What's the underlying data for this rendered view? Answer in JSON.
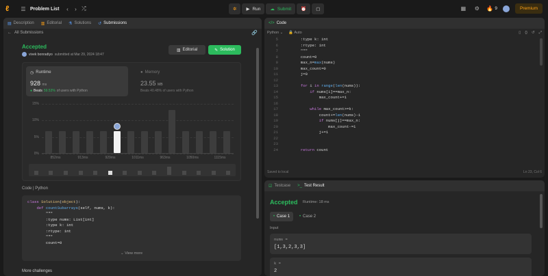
{
  "topbar": {
    "problem_list": "Problem List",
    "run": "Run",
    "submit": "Submit",
    "streak": "9",
    "premium": "Premium"
  },
  "left": {
    "tabs": [
      "Description",
      "Editorial",
      "Solutions",
      "Submissions"
    ],
    "back": "All Submissions",
    "status": "Accepted",
    "user": "vivek bonradiyo",
    "submitted": "submitted at Mar 29, 2024 18:47",
    "editorial_btn": "Editorial",
    "solution_btn": "Solution",
    "runtime_label": "Runtime",
    "runtime_value": "928",
    "runtime_unit": "ms",
    "runtime_beats_prefix": "Beats",
    "runtime_beats_pct": "59.53%",
    "runtime_beats_suffix": "of users with Python",
    "memory_label": "Memory",
    "memory_value": "23.55",
    "memory_unit": "MB",
    "memory_beats": "Beats 40.48% of users with Python",
    "code_label": "Code",
    "code_lang": "Python",
    "view_more": "View more",
    "more_challenges": "More challenges"
  },
  "chart_data": {
    "type": "bar",
    "ylim": [
      0,
      15
    ],
    "y_ticks": [
      "15%",
      "10%",
      "5%",
      "0%"
    ],
    "x_ticks": [
      "852ms",
      "913ms",
      "929ms",
      "1011ms",
      "963ms",
      "1050ms",
      "1115ms"
    ],
    "values": [
      6.5,
      6.5,
      6.5,
      6.5,
      6.5,
      6.5,
      6.5,
      6.5,
      6.5,
      13,
      6.5,
      6.5,
      6.5,
      6.5
    ],
    "highlight_index": 5
  },
  "left_code": [
    {
      "t": "class Solution(object):"
    },
    {
      "t": "    def countSubarrays(self, nums, k):"
    },
    {
      "t": "        \"\"\""
    },
    {
      "t": "        :type nums: List[int]"
    },
    {
      "t": "        :type k: int"
    },
    {
      "t": "        :rtype: int"
    },
    {
      "t": "        \"\"\""
    },
    {
      "t": "        count=0"
    }
  ],
  "right_top": {
    "title": "Code",
    "lang": "Python",
    "auto": "Auto",
    "saved": "Saved to local",
    "cursor": "Ln 23, Col 6"
  },
  "editor_lines": [
    {
      "n": "5",
      "t": "        :type k: int"
    },
    {
      "n": "6",
      "t": "        :rtype: int"
    },
    {
      "n": "7",
      "t": "        \"\"\""
    },
    {
      "n": "8",
      "t": "        count=0"
    },
    {
      "n": "9",
      "t": "        max_n=max(nums)"
    },
    {
      "n": "10",
      "t": "        max_count=0"
    },
    {
      "n": "11",
      "t": "        j=0"
    },
    {
      "n": "12",
      "t": ""
    },
    {
      "n": "13",
      "t": "        for i in range(len(nums)):"
    },
    {
      "n": "14",
      "t": "            if nums[i]==max_n:"
    },
    {
      "n": "15",
      "t": "                max_count+=1"
    },
    {
      "n": "16",
      "t": ""
    },
    {
      "n": "17",
      "t": "            while max_count>=k:"
    },
    {
      "n": "18",
      "t": "                count+=len(nums)-i"
    },
    {
      "n": "19",
      "t": "                if nums[j]==max_n:"
    },
    {
      "n": "20",
      "t": "                    max_count-=1"
    },
    {
      "n": "21",
      "t": "                j+=1"
    },
    {
      "n": "22",
      "t": ""
    },
    {
      "n": "23",
      "t": ""
    },
    {
      "n": "24",
      "t": "        return count"
    }
  ],
  "right_bottom": {
    "tab_testcase": "Testcase",
    "tab_result": "Test Result",
    "status": "Accepted",
    "runtime": "Runtime: 18 ms",
    "case1": "Case 1",
    "case2": "Case 2",
    "input_label": "Input",
    "nums_label": "nums =",
    "nums_value": "[1,3,2,3,3]",
    "k_label": "k =",
    "k_value": "2"
  }
}
